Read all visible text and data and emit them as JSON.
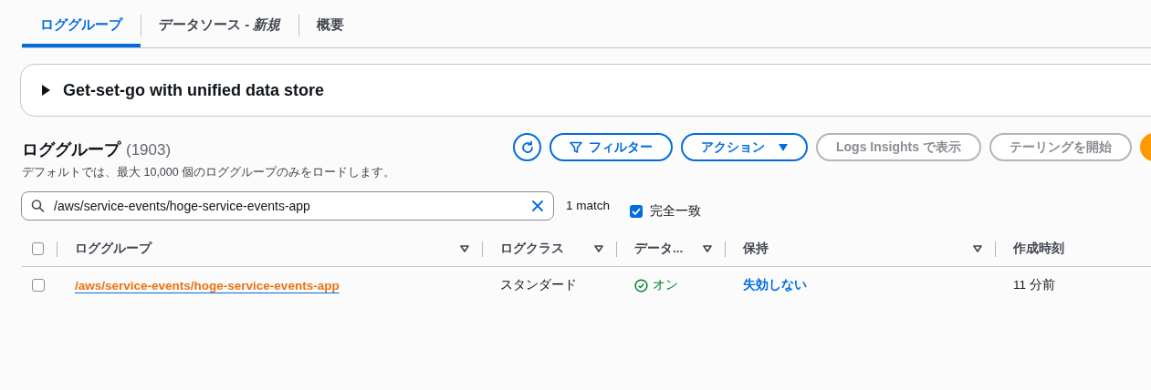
{
  "tabs": [
    {
      "label": "ロググループ",
      "selected": true
    },
    {
      "label": "データソース - *新規*",
      "selected": false
    },
    {
      "label": "概要",
      "selected": false
    }
  ],
  "info_panel": {
    "title": "Get-set-go with unified data store",
    "expanded": false
  },
  "section": {
    "title": "ロググループ",
    "count": "(1903)",
    "description": "デフォルトでは、最大 10,000 個のロググループのみをロードします。"
  },
  "toolbar": [
    {
      "kind": "refresh"
    },
    {
      "kind": "filter",
      "label": "フィルター"
    },
    {
      "kind": "dropdown",
      "label": "アクション"
    },
    {
      "kind": "disabled",
      "label": "Logs Insights で表示"
    },
    {
      "kind": "disabled",
      "label": "テーリングを開始"
    },
    {
      "kind": "primary"
    }
  ],
  "search": {
    "value": "/aws/service-events/hoge-service-events-app",
    "match_text": "1 match"
  },
  "exact_match": {
    "label": "完全一致",
    "checked": true
  },
  "table": {
    "select_all": {
      "checked": false
    },
    "columns": [
      {
        "label": "ロググループ",
        "sortable": true
      },
      {
        "label": "ログクラス",
        "sortable": true
      },
      {
        "label": "データ...",
        "sortable": true
      },
      {
        "label": "保持",
        "sortable": true
      },
      {
        "label": "作成時刻",
        "sortable": false
      }
    ],
    "rows": [
      {
        "checked": false,
        "log_group": "/aws/service-events/hoge-service-events-app",
        "log_class": "スタンダード",
        "data_protection": {
          "label": "オン",
          "on": true
        },
        "retention": "失効しない",
        "created": "11 分前"
      }
    ]
  }
}
